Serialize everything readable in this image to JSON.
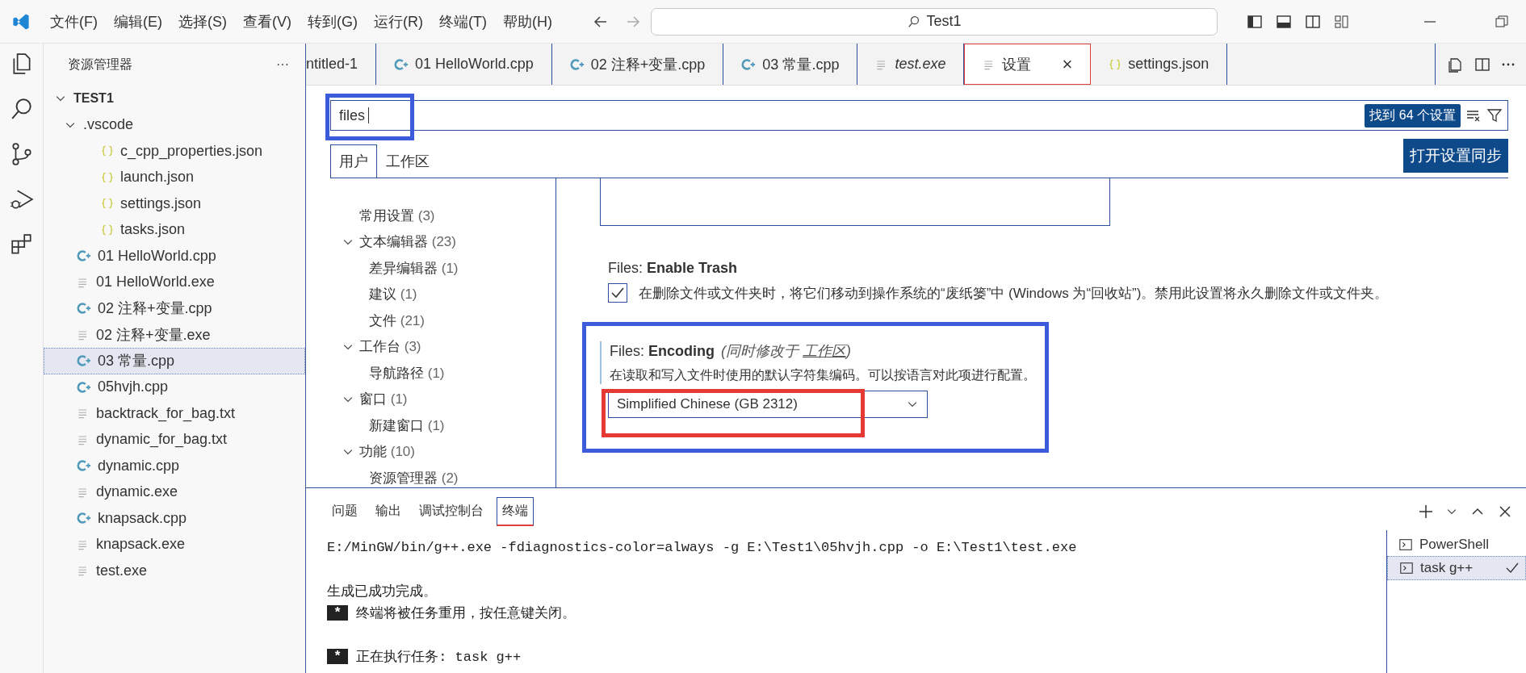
{
  "menu": [
    {
      "label": "文件(F)"
    },
    {
      "label": "编辑(E)"
    },
    {
      "label": "选择(S)"
    },
    {
      "label": "查看(V)"
    },
    {
      "label": "转到(G)"
    },
    {
      "label": "运行(R)"
    },
    {
      "label": "终端(T)"
    },
    {
      "label": "帮助(H)"
    }
  ],
  "command_center": {
    "value": "Test1"
  },
  "explorer": {
    "title": "资源管理器",
    "more": "···",
    "root": {
      "label": "TEST1",
      "expanded": true,
      "children": [
        {
          "label": ".vscode",
          "kind": "folder",
          "expanded": true,
          "selected": false,
          "children": [
            {
              "label": "c_cpp_properties.json",
              "kind": "json",
              "selected": false
            },
            {
              "label": "launch.json",
              "kind": "json",
              "selected": false
            },
            {
              "label": "settings.json",
              "kind": "json",
              "selected": false
            },
            {
              "label": "tasks.json",
              "kind": "json",
              "selected": false
            }
          ]
        },
        {
          "label": "01 HelloWorld.cpp",
          "kind": "cpp",
          "selected": false
        },
        {
          "label": "01 HelloWorld.exe",
          "kind": "text",
          "selected": false
        },
        {
          "label": "02 注释+变量.cpp",
          "kind": "cpp",
          "selected": false
        },
        {
          "label": "02 注释+变量.exe",
          "kind": "text",
          "selected": false
        },
        {
          "label": "03 常量.cpp",
          "kind": "cpp",
          "selected": true
        },
        {
          "label": "05hvjh.cpp",
          "kind": "cpp",
          "selected": false
        },
        {
          "label": "backtrack_for_bag.txt",
          "kind": "text",
          "selected": false
        },
        {
          "label": "dynamic_for_bag.txt",
          "kind": "text",
          "selected": false
        },
        {
          "label": "dynamic.cpp",
          "kind": "cpp",
          "selected": false
        },
        {
          "label": "dynamic.exe",
          "kind": "text",
          "selected": false
        },
        {
          "label": "knapsack.cpp",
          "kind": "cpp",
          "selected": false
        },
        {
          "label": "knapsack.exe",
          "kind": "text",
          "selected": false
        },
        {
          "label": "test.exe",
          "kind": "text",
          "selected": false
        }
      ]
    }
  },
  "tabs": [
    {
      "label": "ntitled-1",
      "kind": "none",
      "selected": false,
      "preview": false
    },
    {
      "label": "01 HelloWorld.cpp",
      "kind": "cpp",
      "selected": false,
      "preview": false
    },
    {
      "label": "02 注释+变量.cpp",
      "kind": "cpp",
      "selected": false,
      "preview": false
    },
    {
      "label": "03 常量.cpp",
      "kind": "cpp",
      "selected": false,
      "preview": false
    },
    {
      "label": "test.exe",
      "kind": "text",
      "selected": false,
      "preview": true
    },
    {
      "label": "设置",
      "kind": "text",
      "selected": true,
      "preview": false,
      "close": "×"
    },
    {
      "label": "settings.json",
      "kind": "json",
      "selected": false,
      "preview": false
    }
  ],
  "settings": {
    "search": {
      "value": "files",
      "annotated": true
    },
    "result_count": "找到 64 个设置",
    "scopes": [
      {
        "label": "用户",
        "selected": true
      },
      {
        "label": "工作区",
        "selected": false
      }
    ],
    "sync_button": "打开设置同步",
    "toc": [
      {
        "label": "常用设置",
        "count": "(3)"
      },
      {
        "label": "文本编辑器",
        "count": "(23)",
        "expanded": true,
        "children": [
          {
            "label": "差异编辑器",
            "count": "(1)"
          },
          {
            "label": "建议",
            "count": "(1)"
          },
          {
            "label": "文件",
            "count": "(21)"
          }
        ]
      },
      {
        "label": "工作台",
        "count": "(3)",
        "expanded": true,
        "children": [
          {
            "label": "导航路径",
            "count": "(1)"
          }
        ]
      },
      {
        "label": "窗口",
        "count": "(1)",
        "expanded": true,
        "children": [
          {
            "label": "新建窗口",
            "count": "(1)"
          }
        ]
      },
      {
        "label": "功能",
        "count": "(10)",
        "expanded": true,
        "children": [
          {
            "label": "资源管理器",
            "count": "(2)"
          }
        ]
      }
    ],
    "items": [
      {
        "kind": "textbox"
      },
      {
        "kind": "checkbox",
        "category": "Files: ",
        "name": "Enable Trash",
        "checked": true,
        "description": "在删除文件或文件夹时，将它们移动到操作系统的“废纸篓”中 (Windows 为“回收站”)。禁用此设置将永久删除文件或文件夹。"
      },
      {
        "kind": "dropdown",
        "category": "Files: ",
        "name": "Encoding",
        "modified_note": "(同时修改于 ",
        "modified_link": "工作区",
        "modified_end": ")",
        "description": "在读取和写入文件时使用的默认字符集编码。可以按语言对此项进行配置。",
        "value": "Simplified Chinese (GB 2312)",
        "annotated": true,
        "value_annotated": true
      }
    ]
  },
  "panel": {
    "tabs": [
      {
        "label": "问题",
        "selected": false
      },
      {
        "label": "输出",
        "selected": false
      },
      {
        "label": "调试控制台",
        "selected": false
      },
      {
        "label": "终端",
        "selected": true
      }
    ],
    "terminal": [
      {
        "kind": "command",
        "text": "E:/MinGW/bin/g++.exe -fdiagnostics-color=always -g E:\\Test1\\05hvjh.cpp -o E:\\Test1\\test.exe"
      },
      {
        "kind": "blank"
      },
      {
        "kind": "text",
        "text": "生成已成功完成。"
      },
      {
        "kind": "star",
        "badge": "*",
        "text": "终端将被任务重用，按任意键关闭。"
      },
      {
        "kind": "blank"
      },
      {
        "kind": "star",
        "badge": "*",
        "text": "正在执行任务: task g++"
      }
    ],
    "terminals": [
      {
        "label": "PowerShell",
        "selected": false
      },
      {
        "label": "task g++",
        "selected": true,
        "done": true
      }
    ]
  }
}
